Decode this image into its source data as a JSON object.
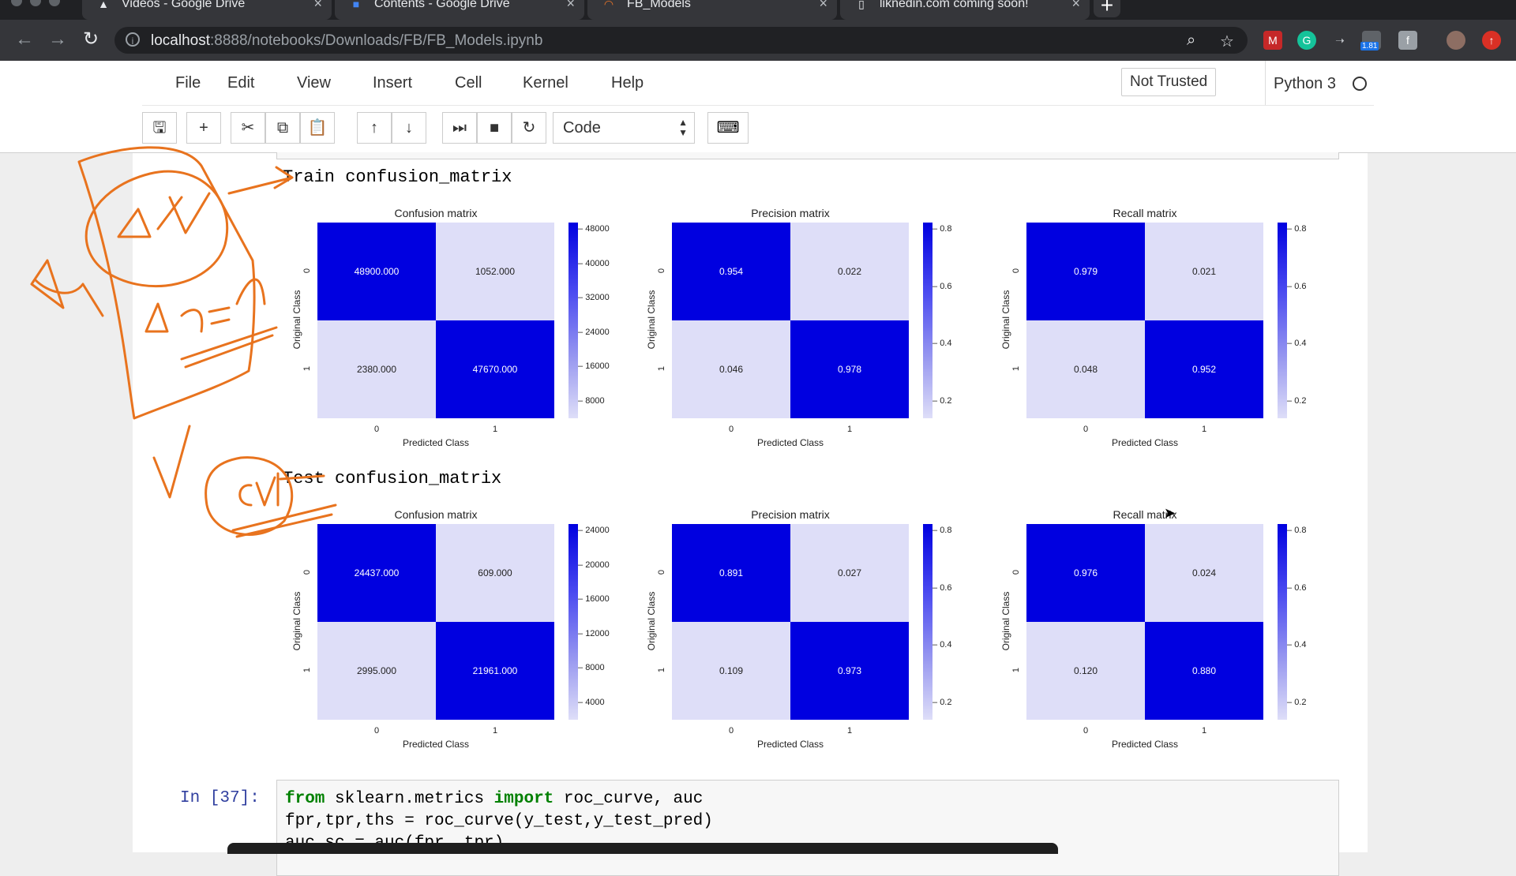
{
  "browser": {
    "tabs": [
      {
        "title": "Videos - Google Drive",
        "icon": "google-drive-icon"
      },
      {
        "title": "Contents - Google Drive",
        "icon": "google-docs-icon"
      },
      {
        "title": "FB_Models",
        "icon": "jupyter-icon"
      },
      {
        "title": "liknedin.com coming soon!",
        "icon": "page-icon"
      }
    ],
    "url_host": "localhost",
    "url_rest": ":8888/notebooks/Downloads/FB/FB_Models.ipynb",
    "extension_badge": "1.81"
  },
  "jupyter": {
    "menus": [
      "File",
      "Edit",
      "View",
      "Insert",
      "Cell",
      "Kernel",
      "Help"
    ],
    "trust": "Not Trusted",
    "kernel": "Python 3",
    "cell_type": "Code"
  },
  "output": {
    "train_label": "Train confusion_matrix",
    "test_label": "Test confusion_matrix"
  },
  "chart_data": [
    {
      "type": "heatmap",
      "title": "Confusion matrix",
      "xlabel": "Predicted Class",
      "ylabel": "Original Class",
      "x_ticks": [
        "0",
        "1"
      ],
      "y_ticks": [
        "0",
        "1"
      ],
      "values": [
        [
          "48900.000",
          "1052.000"
        ],
        [
          "2380.000",
          "47670.000"
        ]
      ],
      "colorbar_ticks": [
        "48000",
        "40000",
        "32000",
        "24000",
        "16000",
        "8000"
      ],
      "cmap": "blue"
    },
    {
      "type": "heatmap",
      "title": "Precision matrix",
      "xlabel": "Predicted Class",
      "ylabel": "Original Class",
      "x_ticks": [
        "0",
        "1"
      ],
      "y_ticks": [
        "0",
        "1"
      ],
      "values": [
        [
          "0.954",
          "0.022"
        ],
        [
          "0.046",
          "0.978"
        ]
      ],
      "colorbar_ticks": [
        "0.8",
        "0.6",
        "0.4",
        "0.2"
      ],
      "cmap": "blue"
    },
    {
      "type": "heatmap",
      "title": "Recall matrix",
      "xlabel": "Predicted Class",
      "ylabel": "Original Class",
      "x_ticks": [
        "0",
        "1"
      ],
      "y_ticks": [
        "0",
        "1"
      ],
      "values": [
        [
          "0.979",
          "0.021"
        ],
        [
          "0.048",
          "0.952"
        ]
      ],
      "colorbar_ticks": [
        "0.8",
        "0.6",
        "0.4",
        "0.2"
      ],
      "cmap": "blue"
    },
    {
      "type": "heatmap",
      "title": "Confusion matrix",
      "xlabel": "Predicted Class",
      "ylabel": "Original Class",
      "x_ticks": [
        "0",
        "1"
      ],
      "y_ticks": [
        "0",
        "1"
      ],
      "values": [
        [
          "24437.000",
          "609.000"
        ],
        [
          "2995.000",
          "21961.000"
        ]
      ],
      "colorbar_ticks": [
        "24000",
        "20000",
        "16000",
        "12000",
        "8000",
        "4000"
      ],
      "cmap": "blue"
    },
    {
      "type": "heatmap",
      "title": "Precision matrix",
      "xlabel": "Predicted Class",
      "ylabel": "Original Class",
      "x_ticks": [
        "0",
        "1"
      ],
      "y_ticks": [
        "0",
        "1"
      ],
      "values": [
        [
          "0.891",
          "0.027"
        ],
        [
          "0.109",
          "0.973"
        ]
      ],
      "colorbar_ticks": [
        "0.8",
        "0.6",
        "0.4",
        "0.2"
      ],
      "cmap": "blue"
    },
    {
      "type": "heatmap",
      "title": "Recall matrix",
      "xlabel": "Predicted Class",
      "ylabel": "Original Class",
      "x_ticks": [
        "0",
        "1"
      ],
      "y_ticks": [
        "0",
        "1"
      ],
      "values": [
        [
          "0.976",
          "0.024"
        ],
        [
          "0.120",
          "0.880"
        ]
      ],
      "colorbar_ticks": [
        "0.8",
        "0.6",
        "0.4",
        "0.2"
      ],
      "cmap": "blue"
    }
  ],
  "code_cell": {
    "prompt": "In [37]:",
    "lines": [
      [
        {
          "t": "from",
          "kw": true
        },
        {
          "t": " sklearn.metrics "
        },
        {
          "t": "import",
          "kw": true
        },
        {
          "t": " roc_curve, auc"
        }
      ],
      [
        {
          "t": "fpr,tpr,ths = roc_curve(y_test,y_test_pred)"
        }
      ],
      [
        {
          "t": "auc_sc = auc(fpr, tpr)"
        }
      ]
    ]
  },
  "colors": {
    "dark_cell": "#0000e0",
    "light_cell": "#dedef8",
    "annotation": "#e8731e",
    "prompt": "#303f9f"
  }
}
